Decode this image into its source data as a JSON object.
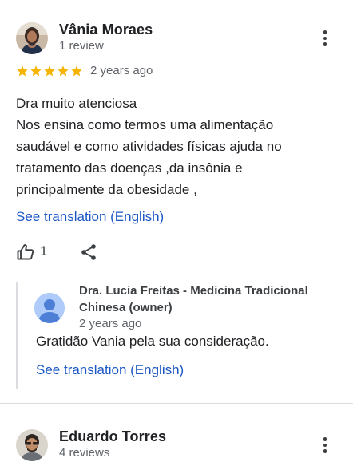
{
  "reviews": [
    {
      "author": "Vânia Moraes",
      "meta": "1 review",
      "rating": 5,
      "date": "2 years ago",
      "text_lines": [
        "Dra muito atenciosa",
        "Nos ensina como termos uma alimentação",
        "saudável e como atividades físicas ajuda no",
        "tratamento das doenças ,da insônia e",
        "principalmente da obesidade ,"
      ],
      "translate_label": "See translation (English)",
      "likes": "1",
      "owner_reply": {
        "name": "Dra. Lucia Freitas - Medicina Tradicional Chinesa (owner)",
        "date": "2 years ago",
        "text": "Gratidão Vania pela sua consideração.",
        "translate_label": "See translation (English)"
      }
    },
    {
      "author": "Eduardo Torres",
      "meta": "4 reviews"
    }
  ],
  "colors": {
    "star": "#f4b400",
    "link": "#1a57c4",
    "muted_text": "#5f6368",
    "divider": "#dadce0",
    "default_avatar": "#aecbfa"
  },
  "icons": [
    "star-icon",
    "more-vert-icon",
    "thumb-up-icon",
    "share-icon",
    "default-avatar-icon"
  ]
}
